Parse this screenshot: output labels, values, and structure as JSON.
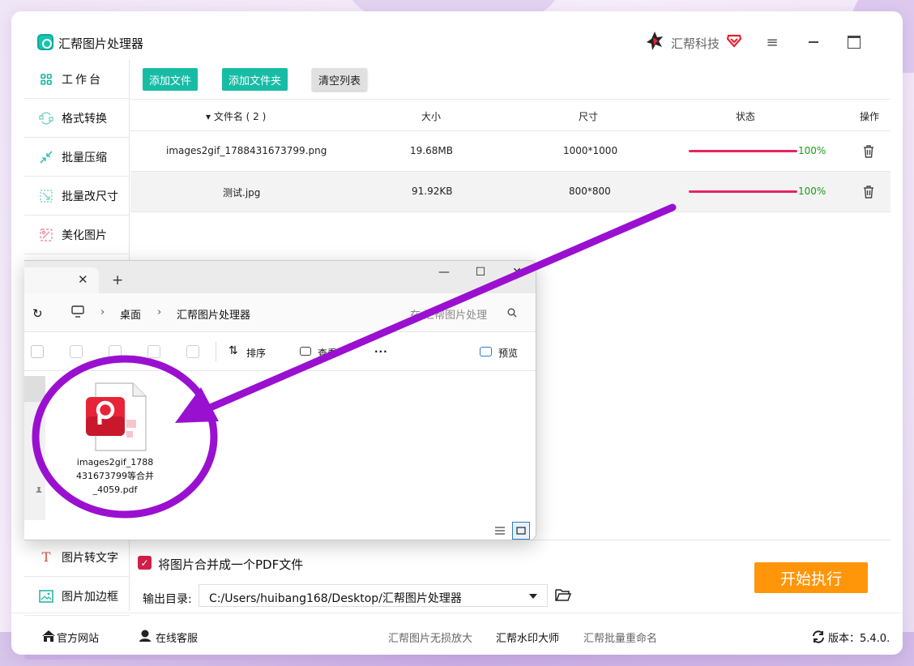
{
  "app": {
    "title": "汇帮图片处理器",
    "brand": "汇帮科技"
  },
  "sidebar": {
    "items": [
      {
        "label": "工作台",
        "icon": "workbench-icon"
      },
      {
        "label": "格式转换",
        "icon": "convert-icon"
      },
      {
        "label": "批量压缩",
        "icon": "compress-icon"
      },
      {
        "label": "批量改尺寸",
        "icon": "resize-icon"
      },
      {
        "label": "美化图片",
        "icon": "beautify-icon"
      },
      {
        "label": "图片转文字",
        "icon": "text-icon"
      },
      {
        "label": "图片加边框",
        "icon": "frame-icon"
      }
    ]
  },
  "toolbar": {
    "add_file": "添加文件",
    "add_folder": "添加文件夹",
    "clear_list": "清空列表"
  },
  "table": {
    "headers": {
      "name": "▾ 文件名 ( 2 )",
      "size": "大小",
      "dimensions": "尺寸",
      "status": "状态",
      "action": "操作"
    },
    "rows": [
      {
        "name": "images2gif_1788431673799.png",
        "size": "19.68MB",
        "dimensions": "1000*1000",
        "progress": 1.0,
        "percent": "100%"
      },
      {
        "name": "测试.jpg",
        "size": "91.92KB",
        "dimensions": "800*800",
        "progress": 1.0,
        "percent": "100%"
      }
    ]
  },
  "options": {
    "merge_label": "将图片合并成一个PDF文件",
    "merge_checked": true,
    "output_label": "输出目录:",
    "output_path": "C:/Users/huibang168/Desktop/汇帮图片处理器",
    "start_button": "开始执行"
  },
  "footer": {
    "website": "官方网站",
    "support": "在线客服",
    "link1": "汇帮图片无损放大",
    "link2": "汇帮水印大师",
    "link3": "汇帮批量重命名",
    "version": "版本：5.4.0."
  },
  "explorer": {
    "breadcrumb": [
      "桌面",
      "汇帮图片处理器"
    ],
    "search_placeholder": "在 汇帮图片处理",
    "commands": {
      "sort": "排序",
      "view": "查看",
      "more": "···",
      "preview": "预览"
    },
    "file": {
      "name": "images2gif_1788431673799等合并_4059.pdf",
      "type": "pdf-icon"
    }
  },
  "colors": {
    "accent": "#17bca5",
    "progress": "#e8245f",
    "start": "#ff960a",
    "annotation": "#9a10d0"
  }
}
